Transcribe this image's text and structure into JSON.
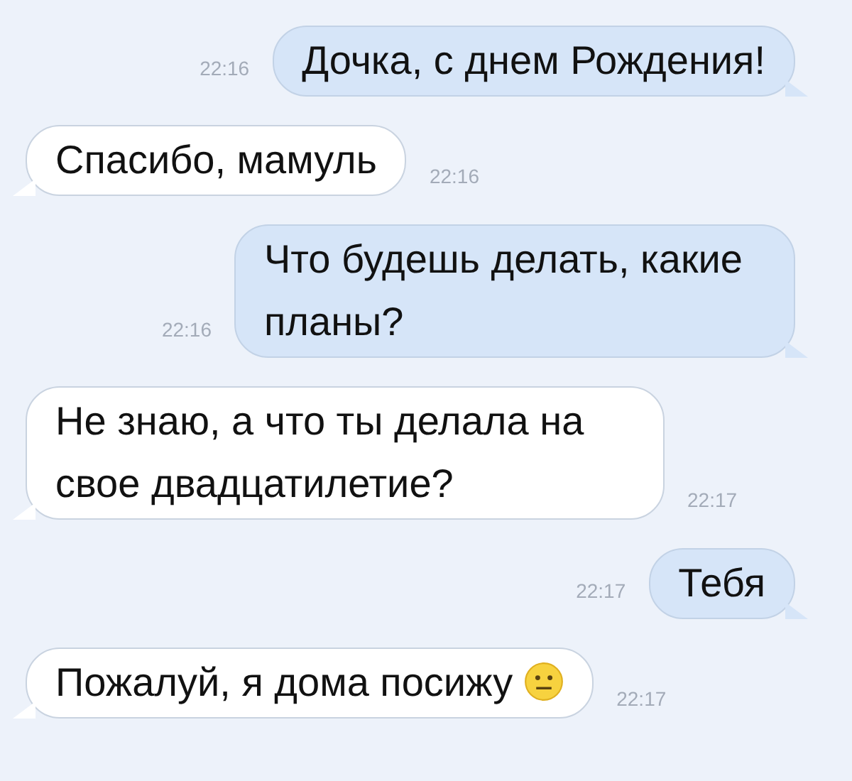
{
  "messages": [
    {
      "kind": "sent",
      "text": "Дочка, с днем Рождения!",
      "time": "22:16",
      "emoji": false
    },
    {
      "kind": "received",
      "text": "Спасибо, мамуль",
      "time": "22:16",
      "emoji": false
    },
    {
      "kind": "sent",
      "text": "Что будешь делать, какие планы?",
      "time": "22:16",
      "emoji": false
    },
    {
      "kind": "received",
      "text": "Не знаю, а что ты делала на свое двадцатилетие?",
      "time": "22:17",
      "emoji": false
    },
    {
      "kind": "sent",
      "text": "Тебя",
      "time": "22:17",
      "emoji": false
    },
    {
      "kind": "received",
      "text": "Пожалуй, я дома посижу",
      "time": "22:17",
      "emoji": true
    }
  ]
}
